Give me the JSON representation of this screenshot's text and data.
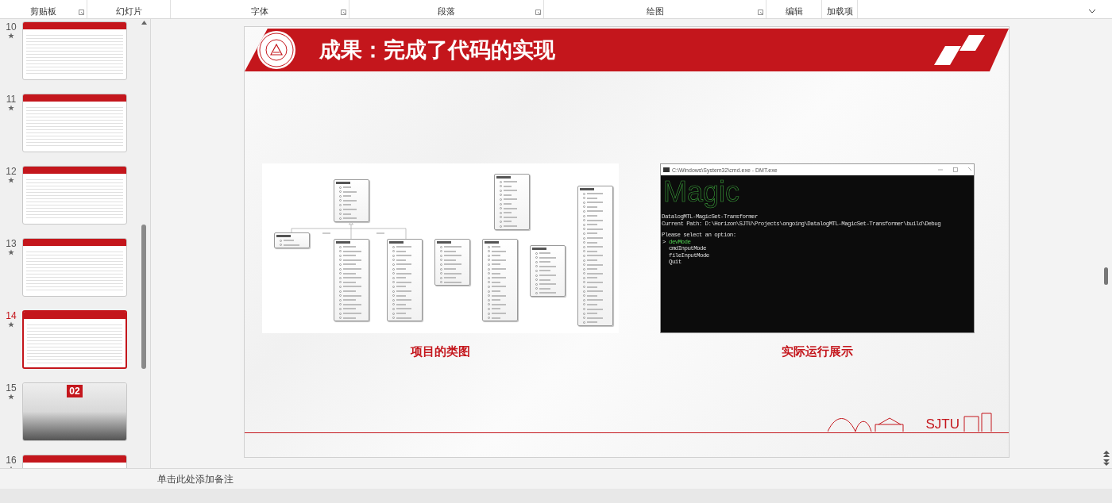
{
  "ribbon": {
    "groups": [
      {
        "label": "剪贴板",
        "launcher": true
      },
      {
        "label": "幻灯片",
        "launcher": false
      },
      {
        "label": "字体",
        "launcher": true
      },
      {
        "label": "段落",
        "launcher": true
      },
      {
        "label": "绘图",
        "launcher": true
      },
      {
        "label": "编辑",
        "launcher": false
      },
      {
        "label": "加载项",
        "launcher": false
      }
    ]
  },
  "thumbnails": [
    {
      "number": "10",
      "starred": true,
      "selected": false,
      "kind": "content"
    },
    {
      "number": "11",
      "starred": true,
      "selected": false,
      "kind": "content"
    },
    {
      "number": "12",
      "starred": true,
      "selected": false,
      "kind": "content"
    },
    {
      "number": "13",
      "starred": true,
      "selected": false,
      "kind": "content"
    },
    {
      "number": "14",
      "starred": true,
      "selected": true,
      "kind": "content"
    },
    {
      "number": "15",
      "starred": true,
      "selected": false,
      "kind": "section",
      "section_number": "02"
    },
    {
      "number": "16",
      "starred": true,
      "selected": false,
      "kind": "content"
    }
  ],
  "slide": {
    "title": "成果：完成了代码的实现",
    "diagram_caption": "项目的类图",
    "terminal": {
      "title": "C:\\Windows\\System32\\cmd.exe - DMT.exe",
      "banner": "Magic",
      "lines": [
        "DatalogMTL-MagicSet-Transformer",
        "Current Path: D:\\Horizon\\SJTU\\Projects\\ongoing\\DatalogMTL-MagicSet-Transformer\\build\\Debug"
      ],
      "prompt": "Please select an option:",
      "marker": ">",
      "options": [
        {
          "label": "devMode",
          "selected": true
        },
        {
          "label": "cmdInputMode",
          "selected": false
        },
        {
          "label": "fileInputMode",
          "selected": false
        },
        {
          "label": "Quit",
          "selected": false
        }
      ]
    },
    "terminal_caption": "实际运行展示",
    "footer_logo_text": "SJTU"
  },
  "notes": {
    "placeholder": "单击此处添加备注"
  }
}
